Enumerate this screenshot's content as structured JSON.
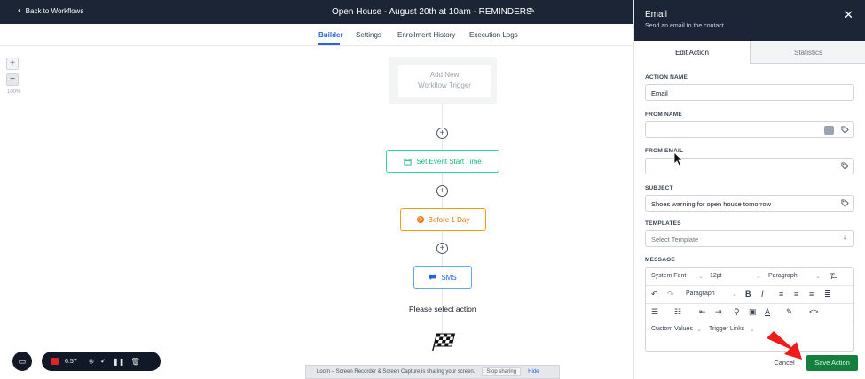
{
  "header": {
    "back_label": "Back to Workflows",
    "title": "Open House - August 20th at 10am - REMINDERS"
  },
  "tabs": [
    {
      "label": "Builder",
      "active": true
    },
    {
      "label": "Settings",
      "active": false
    },
    {
      "label": "Enrollment History",
      "active": false
    },
    {
      "label": "Execution Logs",
      "active": false
    }
  ],
  "canvas": {
    "zoom_in": "+",
    "zoom_out": "−",
    "zoom_level": "100%",
    "trigger_line1": "Add New",
    "trigger_line2": "Workflow Trigger",
    "nodes": [
      {
        "label": "Set Event Start Time",
        "icon": "calendar-icon",
        "color": "#10b981"
      },
      {
        "label": "Before 1 Day",
        "icon": "clock-icon",
        "color": "#d97706"
      },
      {
        "label": "SMS",
        "icon": "chat-icon",
        "color": "#2563eb"
      }
    ],
    "select_action": "Please select action"
  },
  "recorder": {
    "time": "6:57",
    "banner_text": "Loom – Screen Recorder & Screen Capture is sharing your screen.",
    "stop_sharing": "Stop sharing",
    "hide": "Hide"
  },
  "panel": {
    "title": "Email",
    "subtitle": "Send an email to the contact",
    "tabs": [
      {
        "label": "Edit Action",
        "active": true
      },
      {
        "label": "Statistics",
        "active": false
      }
    ],
    "fields": {
      "action_name": {
        "label": "ACTION NAME",
        "value": "Email"
      },
      "from_name": {
        "label": "FROM NAME",
        "value": ""
      },
      "from_email": {
        "label": "FROM EMAIL",
        "value": ""
      },
      "subject": {
        "label": "SUBJECT",
        "value": "Shoes warning for open house tomorrow"
      },
      "templates": {
        "label": "TEMPLATES",
        "placeholder": "Select Template"
      },
      "message": {
        "label": "MESSAGE"
      }
    },
    "editor": {
      "font": "System Font",
      "size": "12pt",
      "block": "Paragraph",
      "block2": "Paragraph",
      "custom_values": "Custom Values",
      "trigger_links": "Trigger Links"
    },
    "cancel": "Cancel",
    "save": "Save Action"
  },
  "colors": {
    "dark_header": "#1b2535",
    "accent": "#2563eb",
    "save": "#15803d",
    "annotation_arrow": "#ef1c1c"
  }
}
